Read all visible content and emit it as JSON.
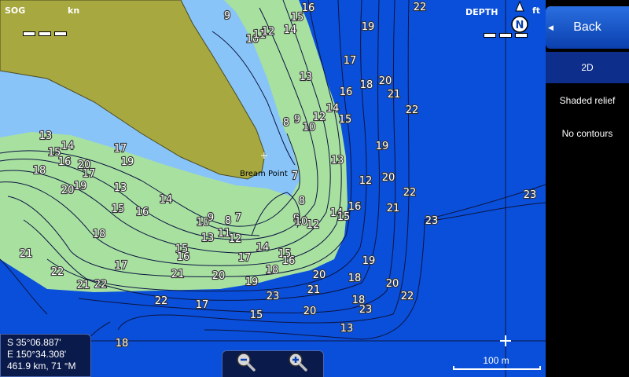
{
  "hud": {
    "sog_label": "SOG",
    "sog_unit": "kn",
    "depth_label": "DEPTH",
    "depth_unit": "ft",
    "north_letter": "N"
  },
  "sidebar": {
    "back_label": "Back",
    "items": [
      {
        "label": "2D",
        "selected": true
      },
      {
        "label": "Shaded relief",
        "selected": false
      },
      {
        "label": "No contours",
        "selected": false
      }
    ]
  },
  "coords": {
    "lat": "S  35°06.887'",
    "lon": "E 150°34.308'",
    "range_bearing": "461.9 km, 71 °M"
  },
  "scale": {
    "label": "100 m"
  },
  "place_label": "Bream Point",
  "colors": {
    "deep": "#0a4fd9",
    "shallow": "#88c4f8",
    "shoal": "#a8e0a0",
    "land": "#a8a840"
  },
  "soundings": [
    "9",
    "15",
    "16",
    "22",
    "19",
    "10",
    "11",
    "12",
    "14",
    "17",
    "13",
    "16",
    "18",
    "20",
    "21",
    "22",
    "8",
    "9",
    "10",
    "12",
    "14",
    "15",
    "13",
    "19",
    "15",
    "14",
    "13",
    "17",
    "16",
    "7",
    "18",
    "20",
    "19",
    "17",
    "13",
    "15",
    "16",
    "14",
    "12",
    "20",
    "22",
    "8",
    "14",
    "15",
    "16",
    "21",
    "23",
    "10",
    "9",
    "8",
    "7",
    "11",
    "12",
    "14",
    "13",
    "18",
    "9",
    "10",
    "12",
    "15",
    "16",
    "17",
    "15",
    "19",
    "18",
    "17",
    "20",
    "16",
    "18",
    "21",
    "20",
    "19",
    "20",
    "22",
    "23",
    "21",
    "22",
    "21",
    "22",
    "23",
    "21",
    "18",
    "23",
    "22",
    "17",
    "20",
    "15",
    "13",
    "18",
    "19",
    "20"
  ]
}
